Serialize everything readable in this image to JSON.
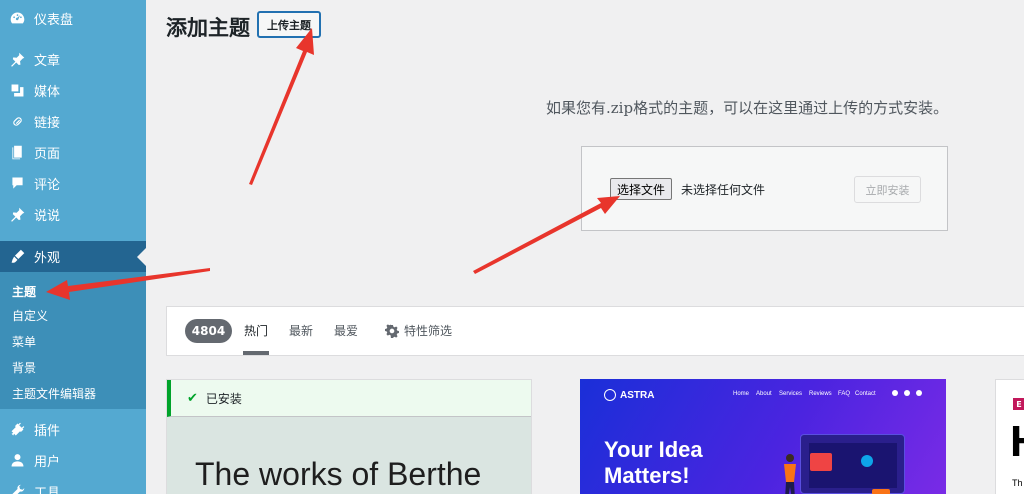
{
  "sidebar": {
    "items": [
      {
        "label": "仪表盘",
        "icon": "dashboard-icon"
      },
      {
        "label": "文章",
        "icon": "pin-icon"
      },
      {
        "label": "媒体",
        "icon": "media-icon"
      },
      {
        "label": "链接",
        "icon": "link-icon"
      },
      {
        "label": "页面",
        "icon": "page-icon"
      },
      {
        "label": "评论",
        "icon": "comment-icon"
      },
      {
        "label": "说说",
        "icon": "pin-icon"
      },
      {
        "label": "外观",
        "icon": "brush-icon"
      },
      {
        "label": "插件",
        "icon": "plugin-icon"
      },
      {
        "label": "用户",
        "icon": "user-icon"
      },
      {
        "label": "工具",
        "icon": "wrench-icon"
      }
    ],
    "submenu": [
      "主题",
      "自定义",
      "菜单",
      "背景",
      "主题文件编辑器"
    ]
  },
  "header": {
    "title": "添加主题",
    "upload_button": "上传主题"
  },
  "upload": {
    "help_text": "如果您有.zip格式的主题，可以在这里通过上传的方式安装。",
    "choose_file": "选择文件",
    "no_file": "未选择任何文件",
    "install_now": "立即安装"
  },
  "filters": {
    "count": "4804",
    "tabs": [
      "热门",
      "最新",
      "最爱"
    ],
    "feature_filter": "特性筛选"
  },
  "themes": {
    "installed_label": "已安装",
    "card1_heading": "The works of Berthe",
    "astra": {
      "logo": "ASTRA",
      "nav": [
        "Home",
        "About",
        "Services",
        "Reviews",
        "FAQ",
        "Contact"
      ],
      "headline_1": "Your Idea",
      "headline_2": "Matters!"
    },
    "card3": {
      "logo": "E",
      "big": "H",
      "small": "Th"
    }
  },
  "colors": {
    "sidebar": "#54a9d1",
    "sidebar_current": "#236591",
    "accent": "#2271b1",
    "annotation": "#e8352c"
  }
}
